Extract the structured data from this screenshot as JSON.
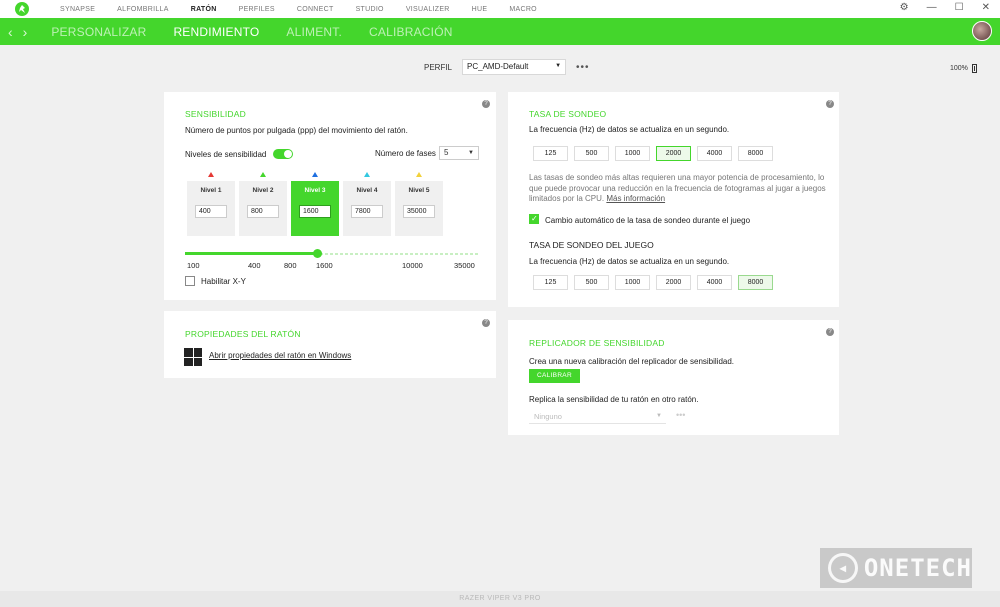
{
  "topnav": [
    "SYNAPSE",
    "ALFOMBRILLA",
    "RATÓN",
    "PERFILES",
    "CONNECT",
    "STUDIO",
    "VISUALIZER",
    "HUE",
    "MACRO"
  ],
  "topnav_active": "RATÓN",
  "subnav": [
    "PERSONALIZAR",
    "RENDIMIENTO",
    "ALIMENT.",
    "CALIBRACIÓN"
  ],
  "subnav_active": "RENDIMIENTO",
  "profile": {
    "label": "PERFIL",
    "value": "PC_AMD-Default"
  },
  "battery": "100%",
  "sensitivity": {
    "title": "SENSIBILIDAD",
    "desc": "Número de puntos por pulgada (ppp) del movimiento del ratón.",
    "levels_label": "Niveles de sensibilidad",
    "stages_label": "Número de fases",
    "stages_value": "5",
    "levels": [
      {
        "name": "Nivel 1",
        "value": "400",
        "color": "#e53935"
      },
      {
        "name": "Nivel 2",
        "value": "800",
        "color": "#44d62c"
      },
      {
        "name": "Nivel 3",
        "value": "1600",
        "color": "#1e6fe0"
      },
      {
        "name": "Nivel 4",
        "value": "7800",
        "color": "#33c8e0"
      },
      {
        "name": "Nivel 5",
        "value": "35000",
        "color": "#f2d13b"
      }
    ],
    "active_level": 3,
    "ticks": [
      "100",
      "400",
      "800",
      "1600",
      "10000",
      "35000"
    ],
    "slider_level": 0.45,
    "xy_label": "Habilitar X-Y"
  },
  "mouse_props": {
    "title": "PROPIEDADES DEL RATÓN",
    "link": "Abrir propiedades del ratón en Windows"
  },
  "polling": {
    "title": "TASA DE SONDEO",
    "desc": "La frecuencia (Hz) de datos se actualiza en un segundo.",
    "rates": [
      "125",
      "500",
      "1000",
      "2000",
      "4000",
      "8000"
    ],
    "selected": "2000",
    "warning_1": "Las tasas de sondeo más altas requieren una mayor potencia de procesamiento, lo",
    "warning_2": "que puede provocar una reducción en la frecuencia de fotogramas al jugar a juegos",
    "warning_3": "limitados por la CPU.",
    "more_info": "Más información",
    "auto_label": "Cambio automático de la tasa de sondeo durante el juego",
    "game_title": "TASA DE SONDEO DEL JUEGO",
    "game_desc": "La frecuencia (Hz) de datos se actualiza en un segundo.",
    "game_selected": "8000"
  },
  "replicator": {
    "title": "REPLICADOR DE SENSIBILIDAD",
    "desc": "Crea una nueva calibración del replicador de sensibilidad.",
    "button": "CALIBRAR",
    "replicate": "Replica la sensibilidad de tu ratón en otro ratón.",
    "select_placeholder": "Ninguno"
  },
  "footer": "RAZER VIPER V3 PRO",
  "watermark": "ONETECH"
}
